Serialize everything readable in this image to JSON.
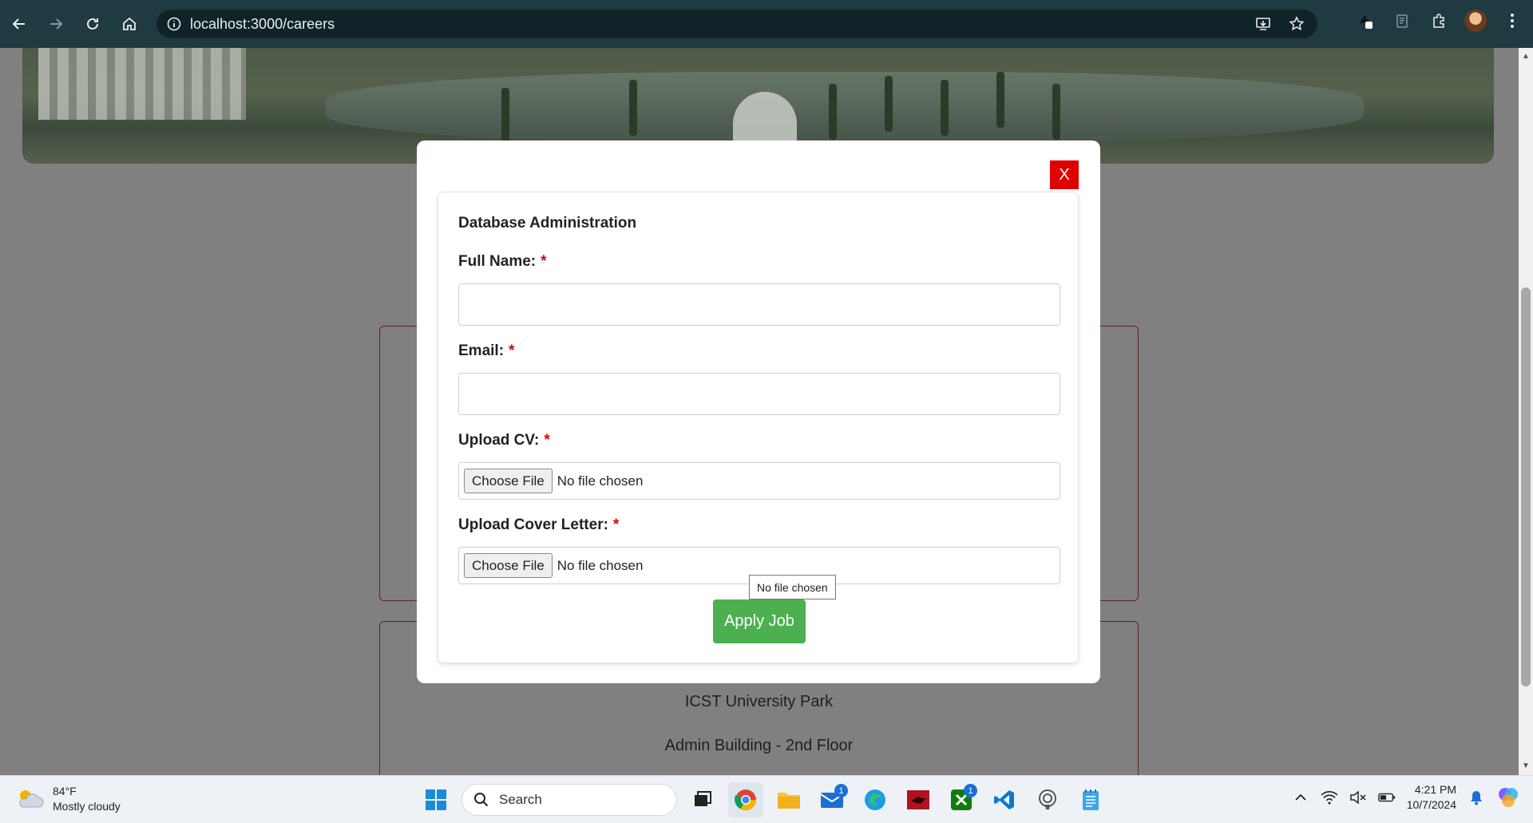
{
  "browser": {
    "url": "localhost:3000/careers"
  },
  "page": {
    "cards": [
      {
        "lines": [
          "ICST University Park",
          "Admin Building - 2nd Floor"
        ]
      }
    ]
  },
  "modal": {
    "close_label": "X",
    "job_title": "Database Administration",
    "fields": {
      "full_name_label": "Full Name:",
      "email_label": "Email:",
      "cv_label": "Upload CV:",
      "cover_label": "Upload Cover Letter:",
      "required_marker": "*",
      "full_name_value": "",
      "email_value": ""
    },
    "file_button_label": "Choose File",
    "file_status": "No file chosen",
    "tooltip": "No file chosen",
    "submit_label": "Apply Job"
  },
  "taskbar": {
    "weather_temp": "84°F",
    "weather_desc": "Mostly cloudy",
    "search_placeholder": "Search",
    "mail_badge": "1",
    "xbox_badge": "1",
    "time": "4:21 PM",
    "date": "10/7/2024"
  }
}
